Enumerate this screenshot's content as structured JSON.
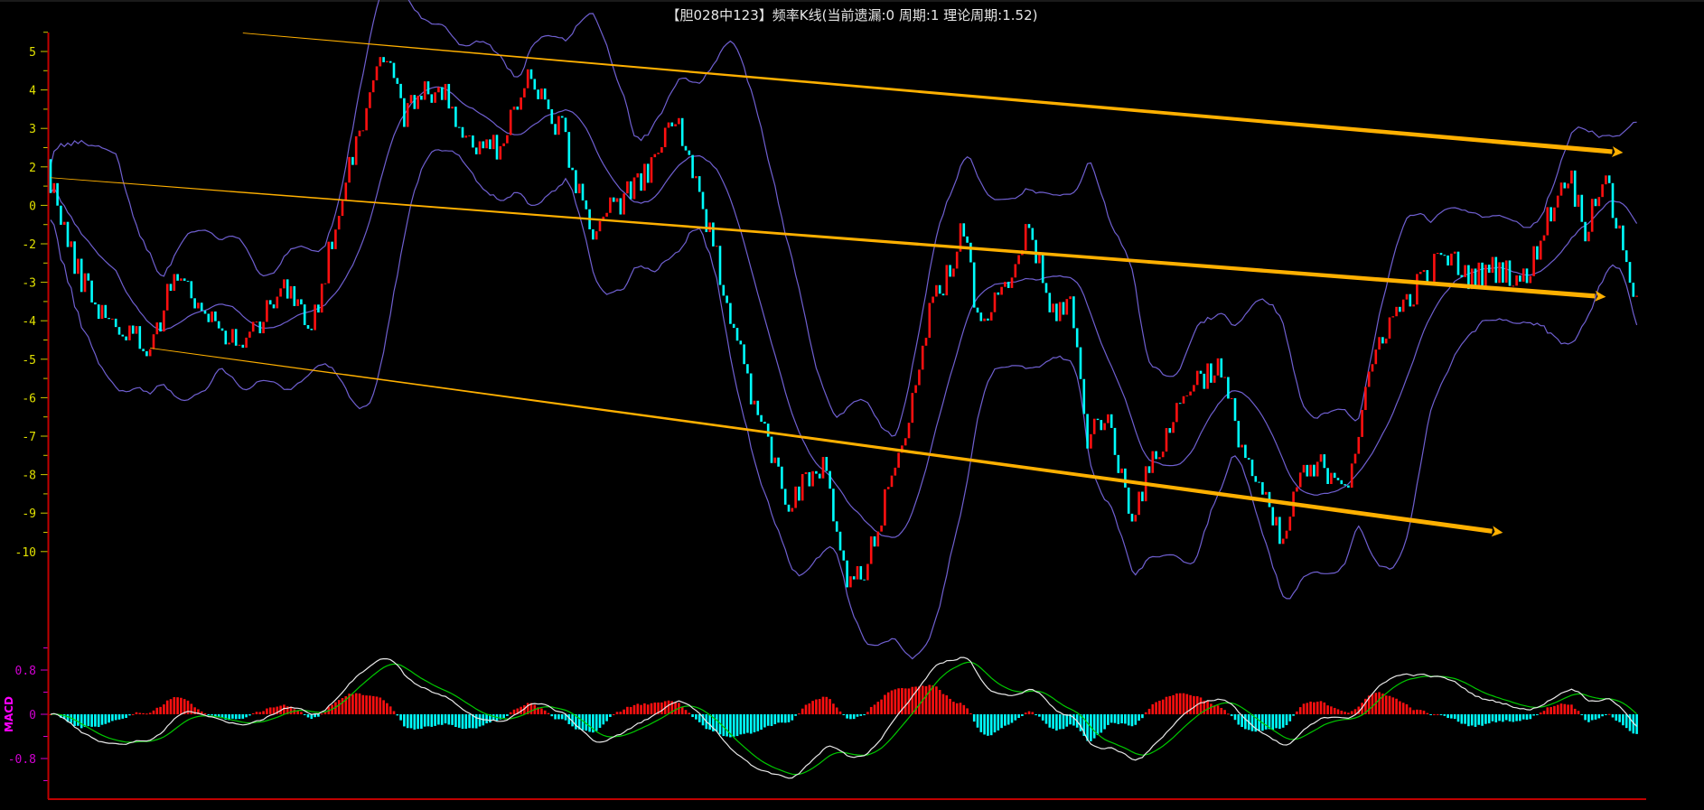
{
  "title": "【胆028中123】频率K线(当前遗漏:0 周期:1 理论周期:1.52)",
  "chart_data": {
    "type": "candlestick",
    "title": "【胆028中123】频率K线(当前遗漏:0 周期:1 理论周期:1.52)",
    "main_panel": {
      "ylim": [
        -10,
        5
      ],
      "y_tick_labels": [
        "5",
        "4",
        "3",
        "2",
        "0",
        "-2",
        "-3",
        "-4",
        "-5",
        "-6",
        "-7",
        "-8",
        "-9",
        "-10"
      ],
      "candle_count": 463,
      "close_waypoints": [
        [
          0,
          1.7
        ],
        [
          7,
          -0.6
        ],
        [
          16,
          -1.9
        ],
        [
          29,
          -2.7
        ],
        [
          37,
          -0.6
        ],
        [
          45,
          -2.0
        ],
        [
          57,
          -2.6
        ],
        [
          67,
          -1.0
        ],
        [
          76,
          -2.3
        ],
        [
          86,
          1.8
        ],
        [
          97,
          5.05
        ],
        [
          103,
          3.4
        ],
        [
          113,
          4.2
        ],
        [
          121,
          2.6
        ],
        [
          130,
          2.5
        ],
        [
          139,
          4.3
        ],
        [
          149,
          2.9
        ],
        [
          157,
          0.4
        ],
        [
          166,
          1.1
        ],
        [
          174,
          1.8
        ],
        [
          182,
          3.4
        ],
        [
          188,
          1.4
        ],
        [
          195,
          -0.7
        ],
        [
          206,
          -4.5
        ],
        [
          215,
          -6.7
        ],
        [
          225,
          -5.8
        ],
        [
          232,
          -8.8
        ],
        [
          237,
          -8.6
        ],
        [
          247,
          -5.5
        ],
        [
          256,
          -1.9
        ],
        [
          266,
          0.4
        ],
        [
          270,
          -2.1
        ],
        [
          278,
          -1.3
        ],
        [
          285,
          0.5
        ],
        [
          291,
          -1.8
        ],
        [
          297,
          -1.5
        ],
        [
          302,
          -5.0
        ],
        [
          307,
          -4.4
        ],
        [
          315,
          -7.0
        ],
        [
          322,
          -5.5
        ],
        [
          332,
          -3.6
        ],
        [
          340,
          -3.2
        ],
        [
          348,
          -5.5
        ],
        [
          359,
          -7.9
        ],
        [
          363,
          -6.2
        ],
        [
          370,
          -5.8
        ],
        [
          378,
          -6.1
        ],
        [
          387,
          -2.4
        ],
        [
          398,
          -1.1
        ],
        [
          406,
          -0.3
        ],
        [
          414,
          -0.9
        ],
        [
          422,
          -0.6
        ],
        [
          430,
          -1.0
        ],
        [
          434,
          0.25
        ],
        [
          442,
          1.9
        ],
        [
          447,
          0.4
        ],
        [
          452,
          1.8
        ],
        [
          458,
          0.0
        ],
        [
          462,
          -1.6
        ]
      ],
      "bollinger": {
        "period": 20,
        "k": 2
      },
      "trend_lines": [
        {
          "from": [
            56,
            5.48
          ],
          "to": [
            458,
            2.37
          ]
        },
        {
          "from": [
            0,
            1.72
          ],
          "to": [
            453,
            -1.38
          ]
        },
        {
          "from": [
            29,
            -2.71
          ],
          "to": [
            423,
            -7.51
          ]
        }
      ]
    },
    "macd_panel": {
      "label": "MACD",
      "ylim": [
        -1.25,
        1.25
      ],
      "y_tick_labels": [
        "0.8",
        "0",
        "-0.8"
      ],
      "y_tick_values": [
        0.8,
        0,
        -0.8
      ],
      "params": {
        "fast": 12,
        "slow": 26,
        "signal": 9
      }
    },
    "colors": {
      "up": "#ff1010",
      "down": "#00ffff",
      "band": "#6f5fd0",
      "trend": "#ffb000",
      "dif": "#e8e8e8",
      "dea": "#00c800",
      "axis": "#c00000",
      "y_label": "#e0e000",
      "macd_label": "#d000d0"
    }
  }
}
